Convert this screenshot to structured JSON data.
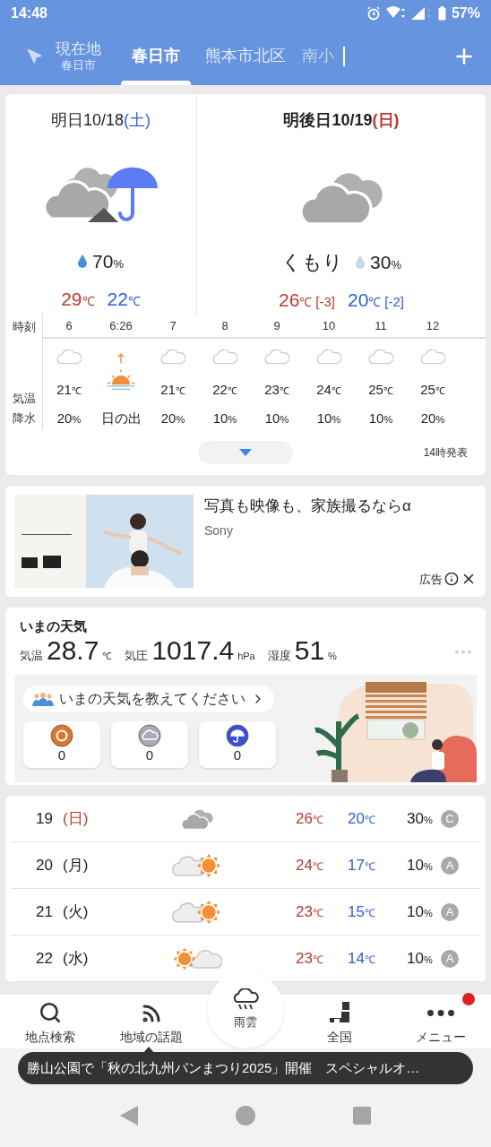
{
  "status_bar": {
    "time": "14:48",
    "battery": "57%"
  },
  "tabs": [
    {
      "kind": "location",
      "label": "現在地",
      "sublabel": "春日市",
      "selected": false,
      "cut": false
    },
    {
      "kind": "city",
      "label": "春日市",
      "selected": true,
      "cut": false
    },
    {
      "kind": "city",
      "label": "熊本市北区",
      "selected": false,
      "cut": false
    },
    {
      "kind": "city",
      "label": "南小",
      "selected": false,
      "cut": true
    }
  ],
  "forecast": {
    "days": [
      {
        "label": "明日",
        "date": "10/18",
        "weekday": "(土)",
        "color": "#2c5fd6",
        "kind": "cloudy_then_rain",
        "rain_likely": true,
        "precip": "70%",
        "high": "29℃",
        "low": "22℃"
      },
      {
        "label": "明後日",
        "date": "10/19",
        "weekday": "(日)",
        "color": "#b83a2e",
        "kind": "cloudy",
        "weather": "くもり",
        "rain_likely": false,
        "precip": "30%",
        "high": "26℃",
        "high_diff": "[-3]",
        "low": "20℃",
        "low_diff": "[-2]"
      }
    ],
    "row_labels": [
      "時刻",
      "気温",
      "降水"
    ],
    "hours": [
      {
        "time": "6",
        "kind": "cloud_outline",
        "temp": "21℃",
        "precip": "20%"
      },
      {
        "time": "6:26",
        "kind": "sunrise",
        "precip": "日の出"
      },
      {
        "time": "7",
        "kind": "cloud_outline",
        "temp": "21℃",
        "precip": "20%"
      },
      {
        "time": "8",
        "kind": "cloud_outline",
        "temp": "22℃",
        "precip": "10%"
      },
      {
        "time": "9",
        "kind": "cloud_outline",
        "temp": "23℃",
        "precip": "10%"
      },
      {
        "time": "10",
        "kind": "cloud_outline",
        "temp": "24℃",
        "precip": "10%"
      },
      {
        "time": "11",
        "kind": "cloud_outline",
        "temp": "25℃",
        "precip": "10%"
      },
      {
        "time": "12",
        "kind": "cloud_outline",
        "temp": "25℃",
        "precip": "20%"
      }
    ],
    "issued": "14時発表"
  },
  "ad": {
    "headline": "写真も映像も、家族撮るならα",
    "advertiser": "Sony",
    "label": "広告"
  },
  "current": {
    "title": "いまの天気",
    "metrics": [
      {
        "label": "気温",
        "value": "28.7",
        "unit": "℃"
      },
      {
        "label": "気圧",
        "value": "1017.4",
        "unit": "hPa"
      },
      {
        "label": "湿度",
        "value": "51",
        "unit": "%"
      }
    ],
    "prompt": "いまの天気を教えてください",
    "votes": [
      {
        "kind": "sunny",
        "count": "0"
      },
      {
        "kind": "cloudy",
        "count": "0"
      },
      {
        "kind": "rainy",
        "count": "0"
      }
    ]
  },
  "weekly": [
    {
      "day": "19",
      "weekday": "(日)",
      "color": "#b83a2e",
      "kind": "cloudy",
      "high": "26℃",
      "low": "20℃",
      "precip": "30%",
      "rank": "C"
    },
    {
      "day": "20",
      "weekday": "(月)",
      "color": "#222222",
      "kind": "cloud_sun",
      "high": "24℃",
      "low": "17℃",
      "precip": "10%",
      "rank": "A"
    },
    {
      "day": "21",
      "weekday": "(火)",
      "color": "#222222",
      "kind": "cloud_sun",
      "high": "23℃",
      "low": "15℃",
      "precip": "10%",
      "rank": "A"
    },
    {
      "day": "22",
      "weekday": "(水)",
      "color": "#222222",
      "kind": "sun_cloud",
      "high": "23℃",
      "low": "14℃",
      "precip": "10%",
      "rank": "A"
    }
  ],
  "bottom_nav": [
    {
      "kind": "search",
      "label": "地点検索",
      "badge": false
    },
    {
      "kind": "topics",
      "label": "地域の話題",
      "badge": false
    },
    {
      "kind": "rain",
      "label": "雨雲",
      "badge": false
    },
    {
      "kind": "national",
      "label": "全国",
      "badge": false
    },
    {
      "kind": "menu",
      "label": "メニュー",
      "badge": true
    }
  ],
  "ticker": "勝山公園で「秋の北九州パンまつり2025」開催　スペシャルオ…"
}
